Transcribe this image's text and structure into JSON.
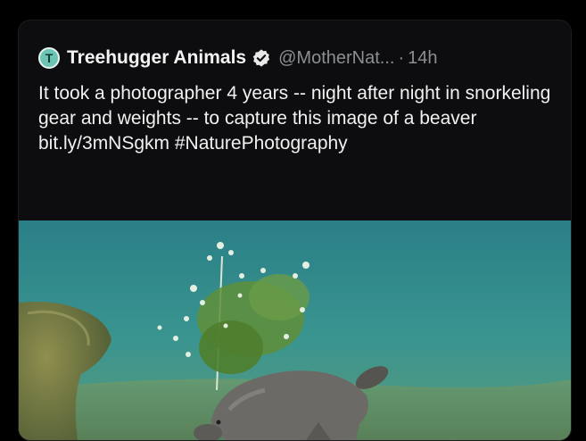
{
  "tweet": {
    "avatar_letter": "T",
    "author_name": "Treehugger Animals",
    "handle": "@MotherNat...",
    "separator": "·",
    "time": "14h",
    "text_main": "It took a photographer 4 years -- night after night in snorkeling gear and weights -- to capture this image of a beaver ",
    "link": "bit.ly/3mNSgkm",
    "hashtag": "#NaturePhotography"
  },
  "colors": {
    "background": "#000000",
    "card": "#0d0d0f",
    "text": "#f1f1f1",
    "muted": "#8b8f94",
    "water": "#2f8a8a"
  },
  "icons": {
    "verified": "verified-badge-icon"
  }
}
